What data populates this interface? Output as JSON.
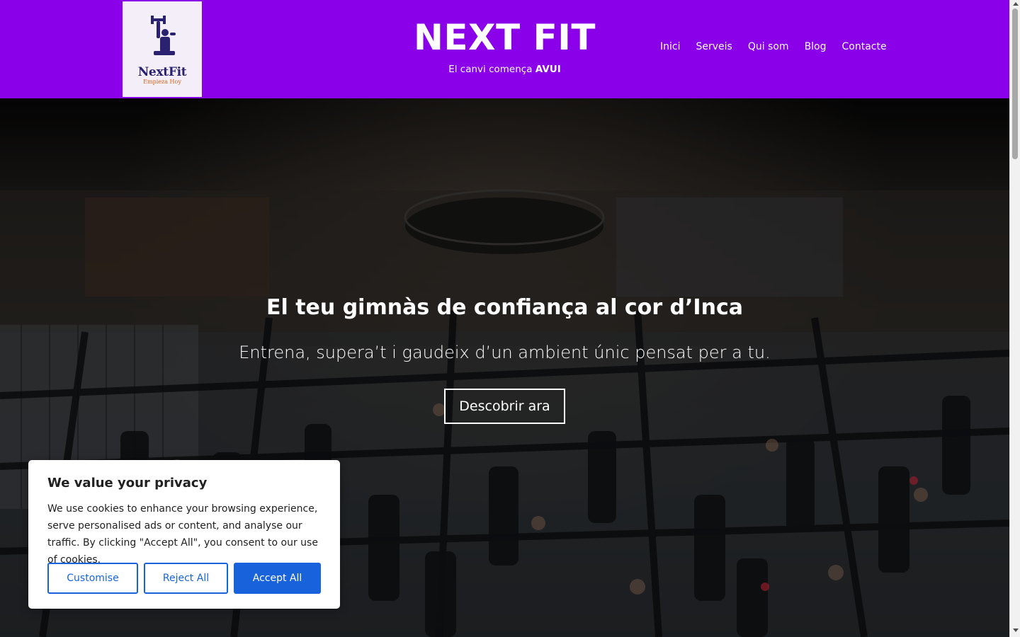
{
  "header": {
    "logo": {
      "wordmark": "NextFit",
      "tagline": "Empieza Hoy"
    },
    "title": "NEXT FIT",
    "tagline_prefix": "El canvi comença",
    "tagline_bold": "AVUI",
    "nav": [
      {
        "label": "Inici"
      },
      {
        "label": "Serveis"
      },
      {
        "label": "Qui som"
      },
      {
        "label": "Blog"
      },
      {
        "label": "Contacte"
      }
    ],
    "bg_color": "#8a00e8"
  },
  "hero": {
    "heading": "El teu gimnàs de confiança al cor d’Inca",
    "subheading": "Entrena, supera’t i gaudeix d’un ambient únic pensat per a tu.",
    "cta_label": "Descobrir ara"
  },
  "cookie_banner": {
    "title": "We value your privacy",
    "text": "We use cookies to enhance your browsing experience, serve personalised ads or content, and analyse our traffic. By clicking \"Accept All\", you consent to our use of cookies.",
    "customise_label": "Customise",
    "reject_label": "Reject All",
    "accept_label": "Accept All",
    "accent_color": "#1863dc"
  }
}
